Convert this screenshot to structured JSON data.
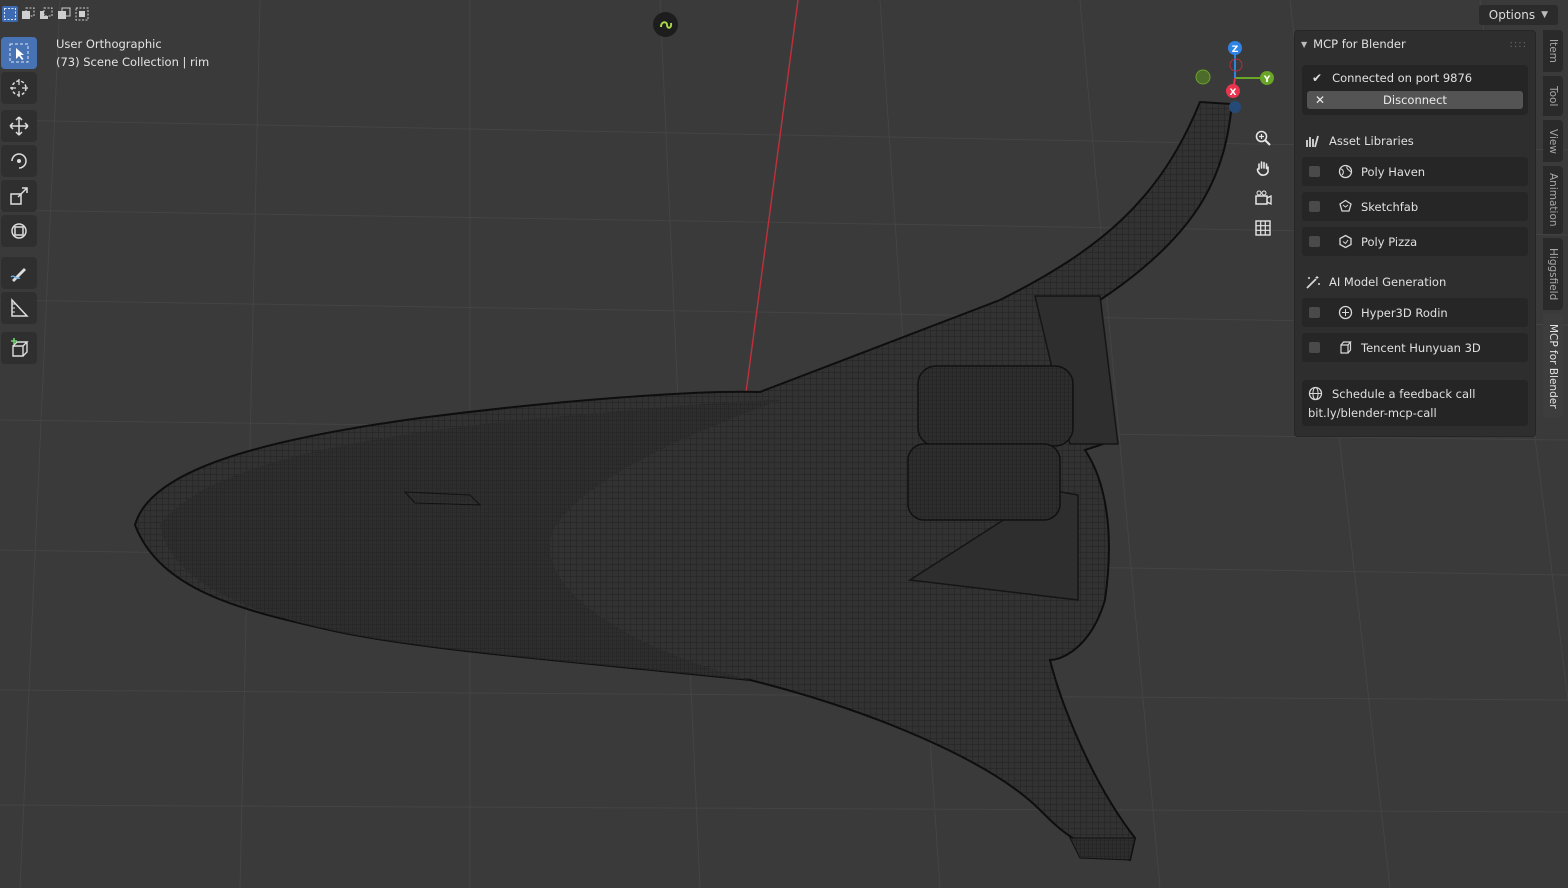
{
  "viewport": {
    "view_name": "User Orthographic",
    "collection_info": "(73) Scene Collection | rim"
  },
  "header": {
    "options_label": "Options",
    "select_modes": [
      "select-box-new",
      "select-box-extend",
      "select-box-subtract",
      "select-box-invert",
      "select-box-intersect"
    ]
  },
  "toolbar": {
    "tools": [
      "select-box",
      "cursor",
      "move",
      "rotate",
      "scale",
      "transform",
      "annotate",
      "measure",
      "add-cube"
    ]
  },
  "gizmo": {
    "x": "X",
    "y": "Y",
    "z": "Z",
    "colors": {
      "x": "#e8344e",
      "y": "#6aa527",
      "z": "#2f84e3"
    }
  },
  "panel": {
    "title": "MCP for Blender",
    "status_text": "Connected on port 9876",
    "disconnect_label": "Disconnect",
    "asset_libraries": {
      "title": "Asset Libraries",
      "items": [
        {
          "label": "Poly Haven",
          "icon": "globe-icon",
          "checked": false
        },
        {
          "label": "Sketchfab",
          "icon": "sketchfab-icon",
          "checked": false
        },
        {
          "label": "Poly Pizza",
          "icon": "polypizza-icon",
          "checked": false
        }
      ]
    },
    "ai_generation": {
      "title": "AI Model Generation",
      "items": [
        {
          "label": "Hyper3D Rodin",
          "icon": "hyper3d-icon",
          "checked": false
        },
        {
          "label": "Tencent Hunyuan 3D",
          "icon": "cube-outline-icon",
          "checked": false
        }
      ]
    },
    "feedback": {
      "title": "Schedule a feedback call",
      "link": "bit.ly/blender-mcp-call"
    }
  },
  "side_tabs": [
    "Item",
    "Tool",
    "View",
    "Animation",
    "Higgsfield",
    "MCP for Blender"
  ],
  "active_tab": "MCP for Blender"
}
